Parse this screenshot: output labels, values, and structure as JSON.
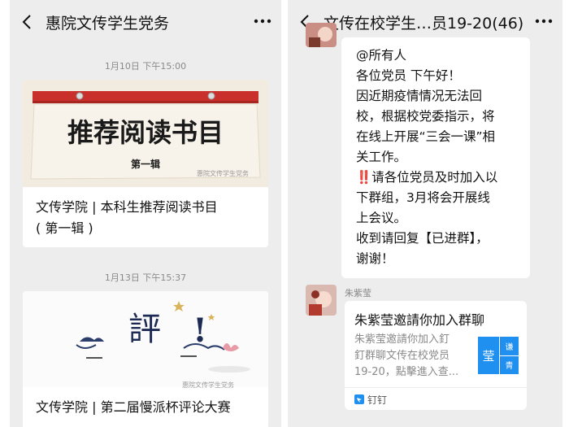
{
  "left": {
    "title": "惠院文传学生党务",
    "article1": {
      "timestamp": "1月10日 下午15:00",
      "cover_title": "推荐阅读书目",
      "cover_subtitle": "第一辑",
      "cover_watermark": "惠院文传学生党务",
      "title_line1": "文传学院 | 本科生推荐阅读书目",
      "title_line2": "( 第一辑 )"
    },
    "article2": {
      "timestamp": "1月13日 下午15:37",
      "cover_title": "評",
      "cover_mark": "!",
      "cover_watermark": "惠院文传学生党务",
      "title_line1": "文传学院 | 第二届慢派杯评论大赛"
    }
  },
  "right": {
    "title": "文传在校学生…员19-20(46)",
    "message": {
      "lines": [
        "@所有人",
        "各位党员 下午好！",
        "    因近期疫情情况无法回",
        "校，根据校党委指示，将",
        "在线上开展“三会一课”相",
        "关工作。",
        "‼️请各位党员及时加入以",
        "下群组，3月将会开展线",
        "上会议。",
        "收到请回复【已进群】，",
        "谢谢！"
      ]
    },
    "invite": {
      "sender": "朱紫莹",
      "title": "朱紫莹邀請你加入群聊",
      "desc_lines": [
        "朱紫莹邀請你加入釘",
        "釘群聊文传在校党员",
        "19-20，點擊進入查..."
      ],
      "thumb_char": "莹",
      "thumb_side": [
        "谦",
        "青"
      ],
      "source": "钉钉"
    }
  },
  "colors": {
    "background": "#ededed",
    "bubble": "#ffffff",
    "cover_red": "#c9302c",
    "dingtalk_blue": "#1f8ff0"
  }
}
